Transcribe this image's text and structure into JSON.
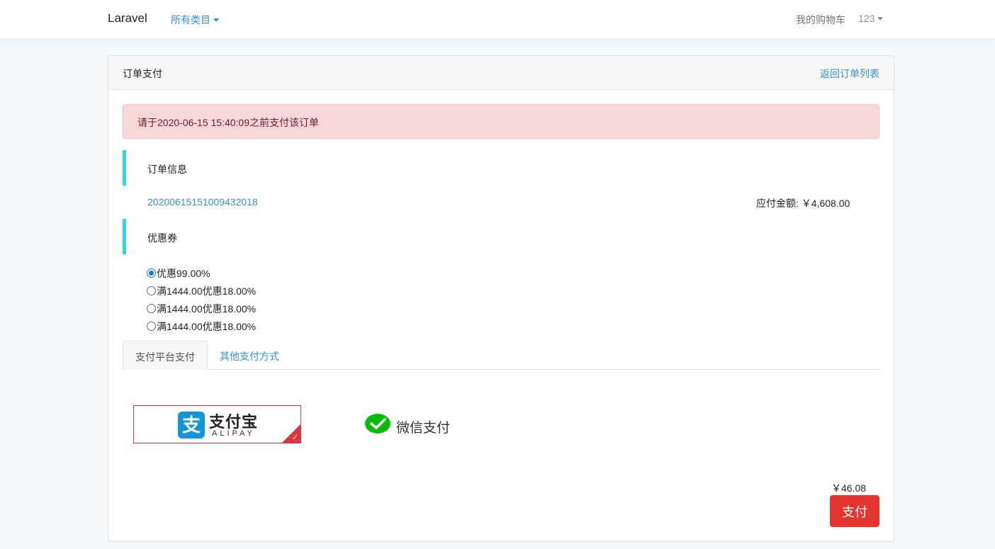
{
  "nav": {
    "brand": "Laravel",
    "categories": "所有类目",
    "cart": "我的购物车",
    "user": "123"
  },
  "card": {
    "title": "订单支付",
    "back_link": "返回订单列表",
    "alert": "请于2020-06-15 15:40:09之前支付该订单"
  },
  "order": {
    "section_title": "订单信息",
    "order_no": "20200615151009432018",
    "amount_label": "应付金额:",
    "amount_value": "￥4,608.00"
  },
  "coupons": {
    "section_title": "优惠券",
    "items": [
      {
        "label": "优惠99.00%",
        "checked": true
      },
      {
        "label": "满1444.00优惠18.00%",
        "checked": false
      },
      {
        "label": "满1444.00优惠18.00%",
        "checked": false
      },
      {
        "label": "满1444.00优惠18.00%",
        "checked": false
      }
    ]
  },
  "tabs": {
    "platform": "支付平台支付",
    "other": "其他支付方式"
  },
  "payment": {
    "alipay_cn": "支付宝",
    "alipay_en": "ALIPAY",
    "alipay_logo_glyph": "支",
    "wechat": "微信支付",
    "selected": "alipay",
    "alipay_color": "#1296db",
    "wechat_color": "#09bb07",
    "selected_border_color": "#d9363e"
  },
  "checkout": {
    "total": "￥46.08",
    "pay_button": "支付",
    "button_color": "#e3342f"
  }
}
